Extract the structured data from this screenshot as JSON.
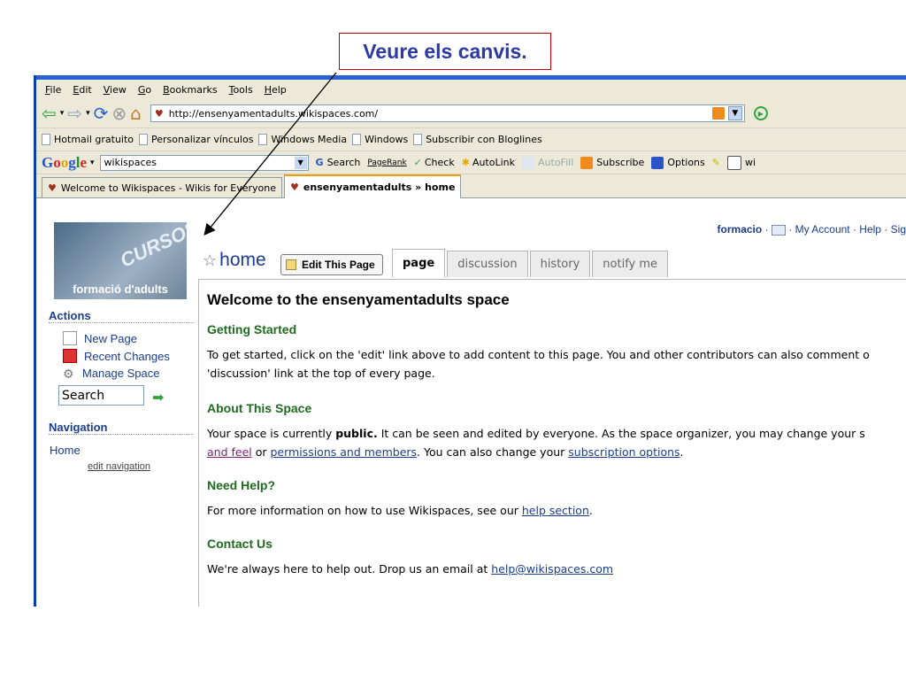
{
  "callout": {
    "text": "Veure els canvis."
  },
  "menubar": {
    "items": [
      "File",
      "Edit",
      "View",
      "Go",
      "Bookmarks",
      "Tools",
      "Help"
    ]
  },
  "navbar": {
    "url": "http://ensenyamentadults.wikispaces.com/"
  },
  "bookmarks": {
    "items": [
      "Hotmail gratuito",
      "Personalizar vínculos",
      "Windows Media",
      "Windows",
      "Subscribir con Bloglines"
    ]
  },
  "google_bar": {
    "search_value": "wikispaces",
    "items": [
      "Search",
      "PageRank",
      "Check",
      "AutoLink",
      "AutoFill",
      "Subscribe",
      "Options",
      "wi"
    ]
  },
  "tabs": [
    {
      "label": "Welcome to Wikispaces - Wikis for Everyone"
    },
    {
      "label": "ensenyamentadults » home"
    }
  ],
  "sidebar": {
    "logo_text": "formació d'adults",
    "logo_scribble": "CURSOS",
    "actions_heading": "Actions",
    "actions": [
      "New Page",
      "Recent Changes",
      "Manage Space"
    ],
    "search_placeholder": "Search",
    "navigation_heading": "Navigation",
    "nav_items": [
      "Home"
    ],
    "edit_navigation": "edit navigation"
  },
  "userbar": {
    "user": "formacio",
    "my_account": "My Account",
    "help": "Help",
    "sign": "Sig"
  },
  "page": {
    "title": "home",
    "edit_button": "Edit This Page",
    "tabs": [
      "page",
      "discussion",
      "history",
      "notify me"
    ],
    "heading": "Welcome to the ensenyamentadults space",
    "sections": {
      "getting_started": {
        "title": "Getting Started",
        "line1": "To get started, click on the 'edit' link above to add content to this page. You and other contributors can also comment o",
        "line2": "'discussion' link at the top of every page."
      },
      "about": {
        "title": "About This Space",
        "line1_pre": "Your space is currently ",
        "line1_bold": "public.",
        "line1_post": " It can be seen and edited by everyone. As the space organizer, you may change your s",
        "link_look": "and feel",
        "or": " or ",
        "link_permissions": "permissions and members",
        "mid": ". You can also change your ",
        "link_subscription": "subscription options",
        "end": "."
      },
      "help": {
        "title": "Need Help?",
        "text": "For more information on how to use Wikispaces, see our ",
        "link": "help section",
        "end": "."
      },
      "contact": {
        "title": "Contact Us",
        "text": "We're always here to help out. Drop us an email at ",
        "link": "help@wikispaces.com"
      }
    }
  }
}
